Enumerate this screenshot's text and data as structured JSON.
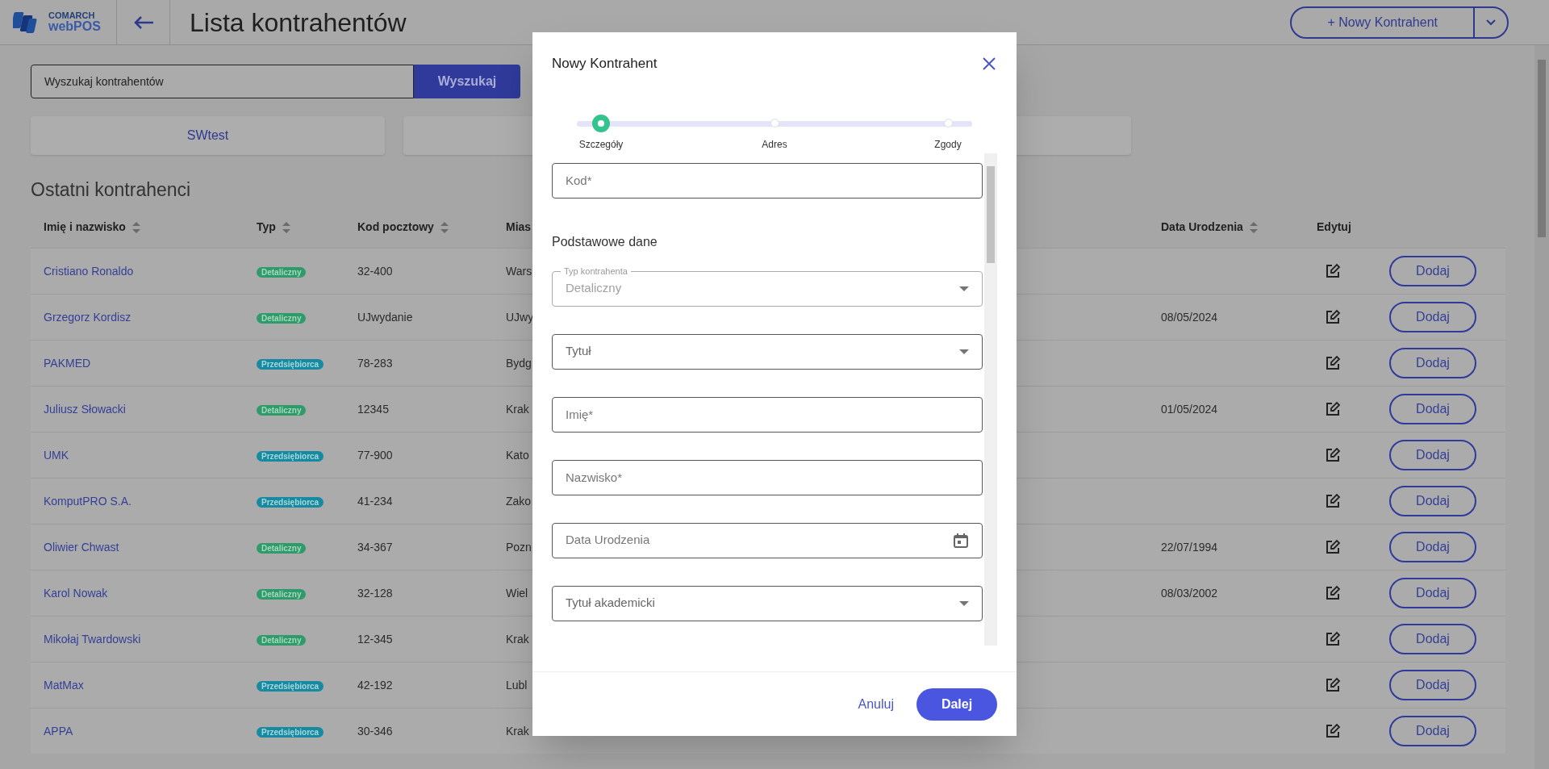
{
  "header": {
    "logo_top": "COMARCH",
    "logo_bottom": "webPOS",
    "title": "Lista kontrahentów",
    "new_button": "+ Nowy Kontrahent"
  },
  "search": {
    "value": "Wyszukaj kontrahentów",
    "button": "Wyszukaj"
  },
  "tiles": [
    "SWtest"
  ],
  "section_title": "Ostatni kontrahenci",
  "table": {
    "columns": [
      {
        "label": "Imię i nazwisko",
        "sortable": true
      },
      {
        "label": "Typ",
        "sortable": true
      },
      {
        "label": "Kod pocztowy",
        "sortable": true
      },
      {
        "label": "Mias",
        "sortable": false
      },
      {
        "label": "Data Urodzenia",
        "sortable": true
      },
      {
        "label": "Edytuj",
        "sortable": false
      }
    ],
    "rows": [
      {
        "name": "Cristiano Ronaldo",
        "type": {
          "label": "Detaliczny",
          "kind": "retail"
        },
        "postal": "32-400",
        "city": "Wars",
        "birth_date": "",
        "action": "Dodaj"
      },
      {
        "name": "Grzegorz Kordisz",
        "type": {
          "label": "Detaliczny",
          "kind": "retail"
        },
        "postal": "UJwydanie",
        "city": "UJwy",
        "birth_date": "08/05/2024",
        "action": "Dodaj"
      },
      {
        "name": "PAKMED",
        "type": {
          "label": "Przedsiębiorca",
          "kind": "business"
        },
        "postal": "78-283",
        "city": "Bydg",
        "birth_date": "",
        "action": "Dodaj"
      },
      {
        "name": "Juliusz Słowacki",
        "type": {
          "label": "Detaliczny",
          "kind": "retail"
        },
        "postal": "12345",
        "city": "Krak",
        "birth_date": "01/05/2024",
        "action": "Dodaj"
      },
      {
        "name": "UMK",
        "type": {
          "label": "Przedsiębiorca",
          "kind": "business"
        },
        "postal": "77-900",
        "city": "Kato",
        "birth_date": "",
        "action": "Dodaj"
      },
      {
        "name": "KomputPRO S.A.",
        "type": {
          "label": "Przedsiębiorca",
          "kind": "business"
        },
        "postal": "41-234",
        "city": "Zako",
        "birth_date": "",
        "action": "Dodaj"
      },
      {
        "name": "Oliwier Chwast",
        "type": {
          "label": "Detaliczny",
          "kind": "retail"
        },
        "postal": "34-367",
        "city": "Pozn",
        "birth_date": "22/07/1994",
        "action": "Dodaj"
      },
      {
        "name": "Karol Nowak",
        "type": {
          "label": "Detaliczny",
          "kind": "retail"
        },
        "postal": "32-128",
        "city": "Wiel",
        "birth_date": "08/03/2002",
        "action": "Dodaj"
      },
      {
        "name": "Mikołaj Twardowski",
        "type": {
          "label": "Detaliczny",
          "kind": "retail"
        },
        "postal": "12-345",
        "city": "Krak",
        "birth_date": "",
        "action": "Dodaj"
      },
      {
        "name": "MatMax",
        "type": {
          "label": "Przedsiębiorca",
          "kind": "business"
        },
        "postal": "42-192",
        "city": "Lubl",
        "birth_date": "",
        "action": "Dodaj"
      },
      {
        "name": "APPA",
        "type": {
          "label": "Przedsiębiorca",
          "kind": "business"
        },
        "postal": "30-346",
        "city": "Krak",
        "birth_date": "",
        "action": "Dodaj"
      }
    ]
  },
  "dialog": {
    "title": "Nowy Kontrahent",
    "steps": [
      {
        "label": "Szczegóły",
        "selected": true
      },
      {
        "label": "Adres",
        "selected": false
      },
      {
        "label": "Zgody",
        "selected": false
      }
    ],
    "fields": [
      {
        "kind": "text",
        "placeholder": "Kod*"
      },
      {
        "kind": "heading",
        "label": "Podstawowe dane"
      },
      {
        "kind": "select",
        "label": "Typ kontrahenta",
        "value": "Detaliczny",
        "disabled": true
      },
      {
        "kind": "select",
        "placeholder": "Tytuł",
        "disabled": false
      },
      {
        "kind": "text",
        "placeholder": "Imię*"
      },
      {
        "kind": "text",
        "placeholder": "Nazwisko*"
      },
      {
        "kind": "date",
        "placeholder": "Data Urodzenia"
      },
      {
        "kind": "select",
        "placeholder": "Tytuł akademicki",
        "disabled": false
      },
      {
        "kind": "cut"
      }
    ],
    "cancel": "Anuluj",
    "next": "Dalej"
  }
}
